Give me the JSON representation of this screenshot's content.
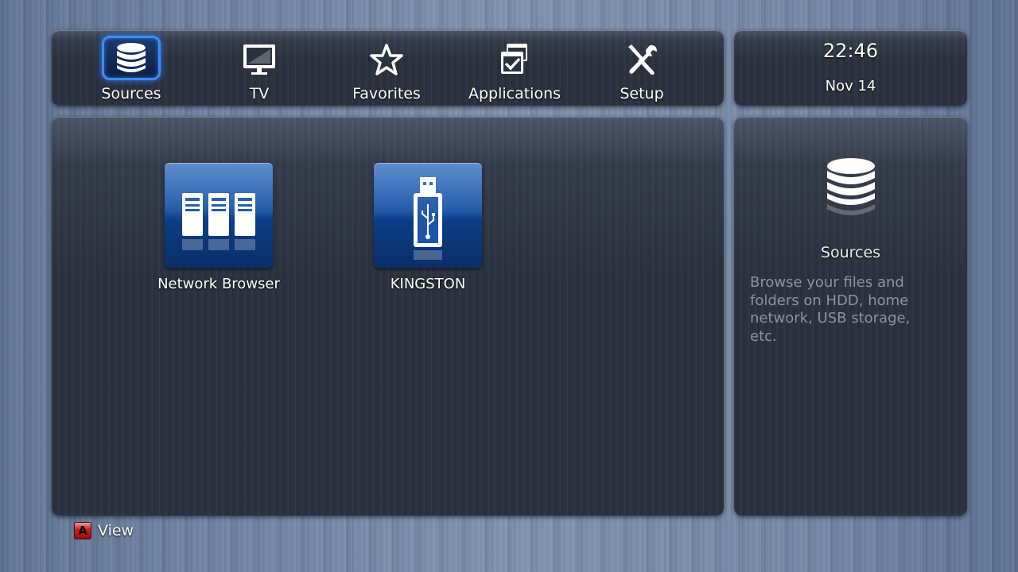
{
  "menu": {
    "items": [
      {
        "label": "Sources",
        "icon": "database-icon",
        "selected": true
      },
      {
        "label": "TV",
        "icon": "tv-icon",
        "selected": false
      },
      {
        "label": "Favorites",
        "icon": "star-icon",
        "selected": false
      },
      {
        "label": "Applications",
        "icon": "applications-icon",
        "selected": false
      },
      {
        "label": "Setup",
        "icon": "setup-tools-icon",
        "selected": false
      }
    ]
  },
  "clock": {
    "time": "22:46",
    "date": "Nov 14"
  },
  "content": {
    "tiles": [
      {
        "label": "Network Browser",
        "icon": "network-servers-icon"
      },
      {
        "label": "KINGSTON",
        "icon": "usb-drive-icon"
      }
    ]
  },
  "info": {
    "title": "Sources",
    "description": "Browse your files and folders on HDD, home network, USB storage, etc.",
    "icon": "database-icon"
  },
  "footer": {
    "key": "A",
    "label": "View"
  },
  "colors": {
    "selection": "#3a8cff",
    "tile_blue": "#1c56a8",
    "key_red": "#d32020",
    "desc_text": "#8e939c"
  }
}
